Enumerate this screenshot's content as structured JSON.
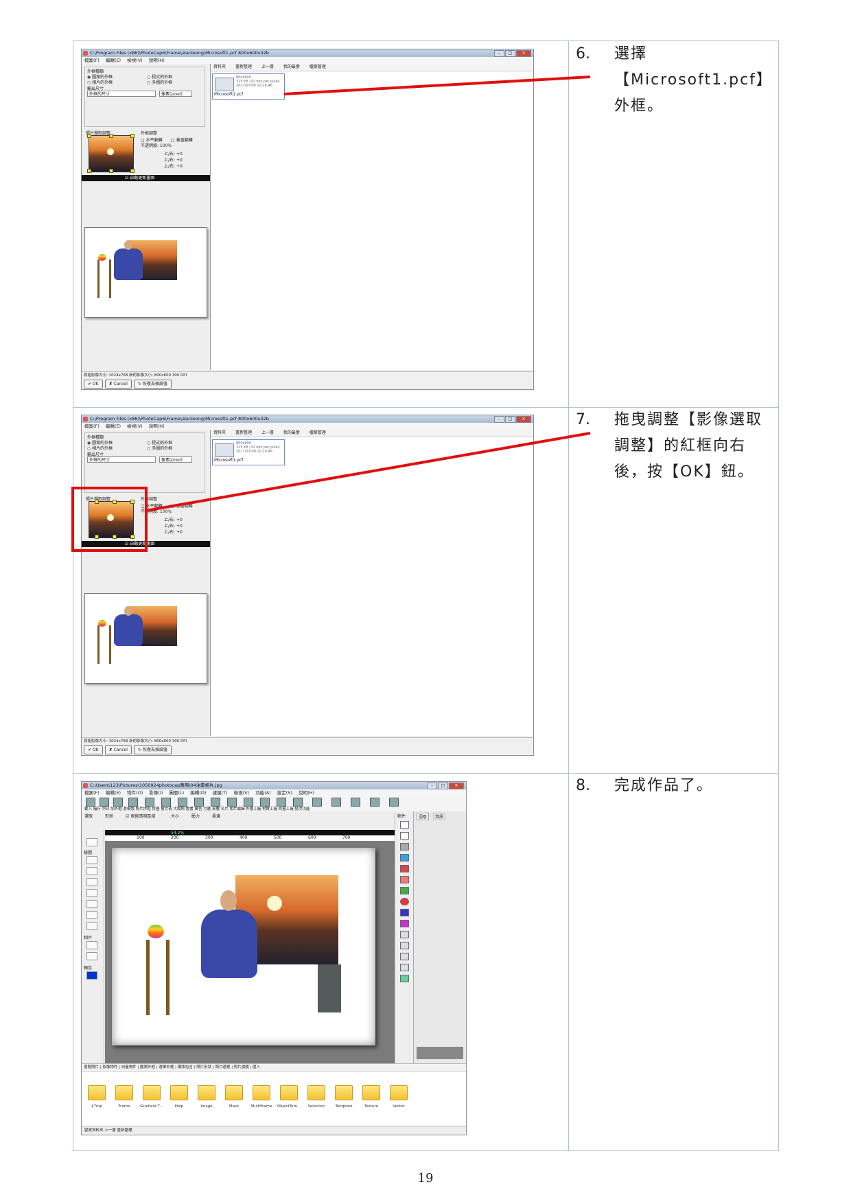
{
  "steps": [
    {
      "num": "6.",
      "text": "選擇【Microsoft1.pcf】外框。"
    },
    {
      "num": "7.",
      "text": "拖曳調整【影像選取調整】的紅框向右後，按【OK】鈕。"
    },
    {
      "num": "8.",
      "text": "完成作品了。"
    }
  ],
  "page_number": "19",
  "frame_window": {
    "title": "C:\\Program Files (x86)\\PhotoCap6\\Frame\\alanleong\\Microsoft1.pcf  800x600x32b",
    "menus": [
      "檔案(F)",
      "編輯(E)",
      "檢視(V)",
      "說明(H)"
    ],
    "group_frame_type": "外框種類",
    "opt_image_frame": "圖案的外框",
    "opt_program_frame": "程式的外框",
    "opt_photo_frame": "相片的外框",
    "opt_multi_frame": "多圖的外框",
    "output_size_label": "輸出尺寸",
    "output_size_value": "外框的尺寸",
    "unit_value": "像素(pixel)",
    "photo_crop_label": "照片擷取調整",
    "frame_adjust_label": "外框調整",
    "flip_h": "水平翻轉",
    "flip_v": "垂直翻轉",
    "opacity": "不透明度: 100%",
    "slider1": "上/右: +0",
    "slider2": "上/右: +0",
    "slider3": "上/右: +0",
    "auto_update": "自動更新畫面",
    "toolbar_items": [
      "資料夾",
      "重新整理",
      "上一層",
      "我的最愛",
      "檔案管理"
    ],
    "file_size": "800x600",
    "file_info": "315 KB (32 bits per pixel)",
    "file_date": "2017/07/09 10:20:46",
    "file_name": "Microsoft1.pcf",
    "status": "原始影像大小: 1024x768    新的影像大小: 800x600 300 DPI",
    "btn_ok": "OK",
    "btn_cancel": "Cancel",
    "btn_default": "恢復為預設值"
  },
  "editor_window": {
    "title": "C:\\Users\\123\\Pictures\\1050924photocap應用\\04油畫相片.jpg",
    "menus": [
      "檔案(F)",
      "編輯(E)",
      "物件(O)",
      "影像(I)",
      "圖層(L)",
      "編輯(D)",
      "濾鏡(T)",
      "檢視(V)",
      "功能(A)",
      "設定(S)",
      "說明(H)"
    ],
    "toolbar_labels": "載入 儲存 列印  加外框 套模版 照片拼貼 拼圖 雙文奇 大頭照 證書 廣告 月曆 桌曆 名片 相片編輯 外框工廠 材質工廠 向量工廠 批次功能",
    "select_label": "選取",
    "shape_label": "形狀",
    "keep_transparent": "保留透明區域",
    "size_label": "大小",
    "pressure_label": "壓力",
    "softness_label": "柔邊",
    "draw_label": "繪圖",
    "photo_label": "相片",
    "color_label": "顏色",
    "zoom": "54.2%",
    "ruler_marks": [
      "100",
      "200",
      "300",
      "400",
      "500",
      "600",
      "700"
    ],
    "object_label": "物件",
    "layer_tab": "圖層",
    "info_tab": "資訊",
    "tabs": "瀏覽照片 | 影像物件 | 向量物件 | 圖案外框 | 選單外框 | 模版包含 | 照片形狀 | 照片邊框 | 照片濾鏡 | 匯入",
    "folders": [
      "$Tmp",
      "Frame",
      "Gradient T...",
      "Help",
      "Image",
      "Mask",
      "MultiFrame",
      "ObjectTem...",
      "Selection",
      "Template",
      "Texture",
      "Vector"
    ],
    "bottom": "變更資料夾   上一層   重新整理"
  }
}
